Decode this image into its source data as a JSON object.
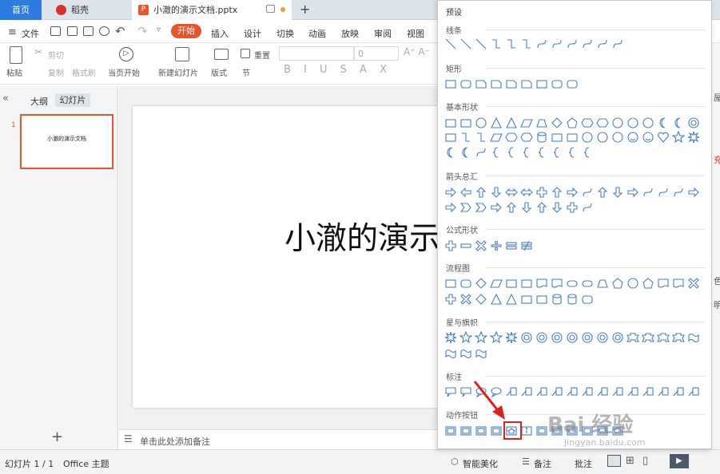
{
  "tabs": {
    "home": "首页",
    "daoke": "稻壳",
    "doc": "小澈的演示文档.pptx"
  },
  "menu": {
    "file": "文件",
    "start": "开始",
    "items": [
      "插入",
      "设计",
      "切换",
      "动画",
      "放映",
      "审阅",
      "视图"
    ]
  },
  "ribbon": {
    "paste": "粘贴",
    "cut": "剪切",
    "copy": "复制",
    "format_painter": "格式刷",
    "from_current": "当页开始",
    "new_slide": "新建幻灯片",
    "layout": "版式",
    "section": "节",
    "reset": "重置",
    "font_size": "0"
  },
  "left_panel": {
    "outline": "大纲",
    "slides": "幻灯片",
    "slide_num": "1",
    "thumb_text": "小澈的演示文档",
    "add": "+"
  },
  "slide": {
    "title": "小澈的演示"
  },
  "notes": {
    "placeholder": "单击此处添加备注"
  },
  "status": {
    "slide_count": "幻灯片 1 / 1",
    "theme": "Office 主题",
    "beautify": "智能美化",
    "notes": "备注",
    "comments": "批注"
  },
  "dropdown": {
    "header": "预设",
    "categories": [
      "线条",
      "矩形",
      "基本形状",
      "箭头总汇",
      "公式形状",
      "流程图",
      "星与旗帜",
      "标注",
      "动作按钮"
    ]
  },
  "watermark": {
    "main": "Bai 经验",
    "sub": "jingyan.baidu.com"
  },
  "right_edge": [
    "屋",
    "色",
    "充",
    "色",
    "明",
    "颜"
  ],
  "colors": {
    "accent": "#e8552b",
    "tab_blue": "#2b7be0",
    "shape_stroke": "#4a7fc1",
    "highlight": "#e0201a"
  }
}
